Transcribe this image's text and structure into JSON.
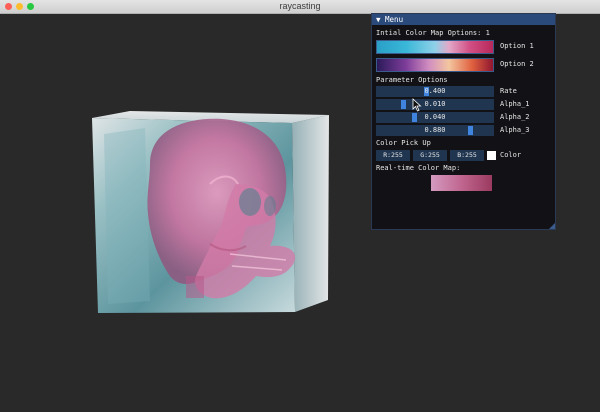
{
  "window": {
    "title": "raycasting"
  },
  "menu": {
    "header": "▼ Menu",
    "color_map_title": "Intial Color Map Options: 1",
    "option1_label": "Option 1",
    "option2_label": "Option 2",
    "parameter_title": "Parameter Options",
    "sliders": [
      {
        "label": "Rate",
        "value_text": "0.400",
        "value": 0.4
      },
      {
        "label": "Alpha_1",
        "value_text": "0.010",
        "value": 0.25
      },
      {
        "label": "Alpha_2",
        "value_text": "0.040",
        "value": 0.3
      },
      {
        "label": "Alpha_3",
        "value_text": "0.880",
        "value": 0.8
      }
    ],
    "color_pick_title": "Color Pick Up",
    "color": {
      "r": "R:255",
      "g": "G:255",
      "b": "B:255",
      "label": "Color",
      "swatch": "#ffffff"
    },
    "realtime_title": "Real-time Color Map:"
  },
  "colors": {
    "panel_header": "#294a7a",
    "slider_bg": "#1f3550",
    "grab": "#3f85e0",
    "background": "#292929"
  }
}
